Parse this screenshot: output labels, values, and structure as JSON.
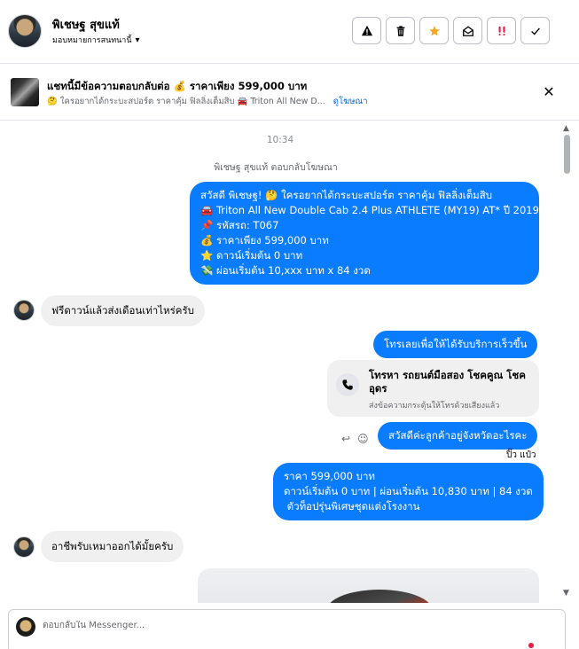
{
  "header": {
    "contact_name": "พิเชษฐ สุขแท้",
    "assign_label": "มอบหมายการสนทนานี้",
    "caret_icon": "caret-down-icon",
    "toolbar": [
      {
        "name": "spam-button",
        "icon": "alert-icon",
        "glyph": "⚠"
      },
      {
        "name": "delete-button",
        "icon": "trash-icon",
        "glyph": "🗑"
      },
      {
        "name": "star-button",
        "icon": "star-icon",
        "glyph": "★"
      },
      {
        "name": "mark-unread-button",
        "icon": "envelope-open-icon",
        "glyph": "✉"
      },
      {
        "name": "follow-up-button",
        "icon": "flag-icon",
        "glyph": "‼"
      },
      {
        "name": "done-button",
        "icon": "check-icon",
        "glyph": "✓"
      }
    ]
  },
  "ad_banner": {
    "title": "แชทนี้มีข้อความตอบกลับต่อ 💰 ราคาเพียง 599,000 บาท",
    "subtitle": "🤔 ใครอยากได้กระบะสปอร์ต ราคาคุ้ม ฟิลลิ่งเต็มสิบ 🚘 Triton All New D...",
    "link": "ดูโฆษณา",
    "close_glyph": "✕"
  },
  "conversation": {
    "timestamp": "10:34",
    "reply_note": "พิเชษฐ สุขแท้ ตอบกลับโฆษณา",
    "msg_ad_reply": [
      "สวัสดี พิเชษฐ! 🤔 ใครอยากได้กระบะสปอร์ต ราคาคุ้ม ฟิลลิ่งเต็มสิบ",
      "🚘 Triton All New Double Cab 2.4 Plus ATHLETE (MY19) AT* ปี 2019",
      "📌 รหัสรถ: T067",
      "💰 ราคาเพียง 599,000 บาท",
      "⭐ ดาวน์เริ่มต้น 0 บาท",
      "💸 ผ่อนเริ่มต้น 10,xxx บาท x 84 งวด"
    ],
    "msg_in_1": "ฟรีดาวน์แล้วส่งเดือนเท่าไหร่ครับ",
    "msg_out_call_prompt": "โทรเลยเพื่อให้ได้รับบริการเร็วขึ้น",
    "call_card": {
      "title": "โทรหา รถยนต์มือสอง โชคคูณ โชค อุดร",
      "subtitle": "ส่งข้อความกระตุ้นให้โทรด้วยเสียงแล้ว",
      "icon": "phone-icon"
    },
    "msg_out_greeting": "สวัสดีค่ะลูกค้าอยู่จังหวัดอะไรคะ",
    "hover_reply_glyph": "↩",
    "hover_react_glyph": "☺",
    "seen_label": "ปิ๊ว แป๋ว",
    "msg_out_price": [
      "ราคา 599,000 บาท",
      "ดาวน์เริ่มต้น 0 บาท | ผ่อนเริ่มต้น 10,830 บาท | 84 งวด",
      " ตัวท็อปรุ่นพิเศษชุดแต่งโรงงาน"
    ],
    "msg_in_2": "อาชีพรับเหมาออกได้มั้ยครับ"
  },
  "composer": {
    "placeholder": "ตอบกลับใน Messenger..."
  }
}
